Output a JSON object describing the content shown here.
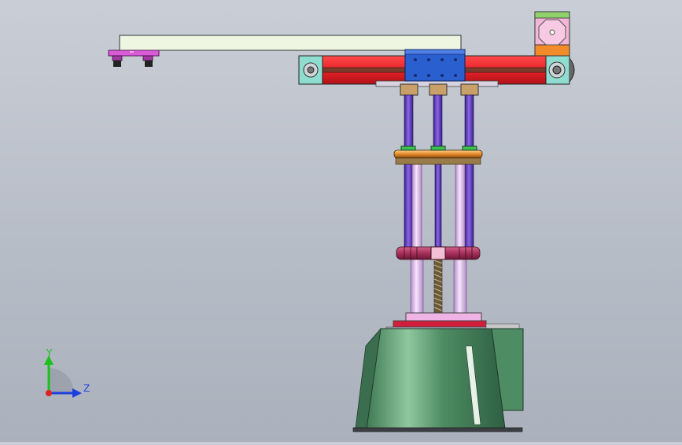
{
  "viewport": {
    "background_top": "#c9ced6",
    "background_bottom": "#aab1bc"
  },
  "colors": {
    "arm_red": "#e8232a",
    "carriage_blue": "#2a5fcf",
    "bearing_cyan": "#8fdcd0",
    "column_purple": "#6b3fc4",
    "column_pink": "#e7c6ef",
    "plate_orange": "#e48a2b",
    "plate_maroon": "#a6305a",
    "base_green": "#5f9a72",
    "gripper_magenta": "#d85bd8",
    "motor_pink": "#f2b6d6",
    "motor_orange": "#f28b2a"
  },
  "triad": {
    "y_label": "Y",
    "z_label": "Z",
    "y_color": "#19c21c",
    "z_color": "#1e3fe0"
  }
}
